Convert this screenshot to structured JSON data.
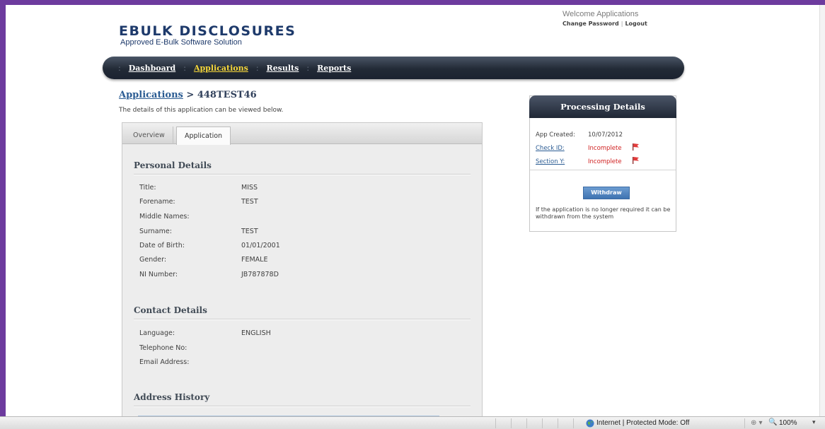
{
  "header": {
    "logo_title": "EBULK DISCLOSURES",
    "logo_subtitle": "Approved E-Bulk Software Solution",
    "welcome": "Welcome Applications",
    "change_password": "Change Password",
    "link_separator": "|",
    "logout": "Logout"
  },
  "nav": {
    "separator": ":",
    "items": [
      {
        "label": "Dashboard",
        "active": false
      },
      {
        "label": "Applications",
        "active": true
      },
      {
        "label": "Results",
        "active": false
      },
      {
        "label": "Reports",
        "active": false
      }
    ]
  },
  "breadcrumb": {
    "parent": "Applications",
    "separator": ">",
    "current": "448TEST46"
  },
  "intro": "The details of this application can be viewed below.",
  "tabs": [
    {
      "label": "Overview",
      "active": false
    },
    {
      "label": "Application",
      "active": true
    }
  ],
  "personal_details": {
    "title": "Personal Details",
    "fields": [
      {
        "label": "Title:",
        "value": "MISS"
      },
      {
        "label": "Forename:",
        "value": "TEST"
      },
      {
        "label": "Middle Names:",
        "value": ""
      },
      {
        "label": "Surname:",
        "value": "TEST"
      },
      {
        "label": "Date of Birth:",
        "value": "01/01/2001"
      },
      {
        "label": "Gender:",
        "value": "FEMALE"
      },
      {
        "label": "NI Number:",
        "value": "JB787878D"
      }
    ]
  },
  "contact_details": {
    "title": "Contact Details",
    "fields": [
      {
        "label": "Language:",
        "value": "ENGLISH"
      },
      {
        "label": "Telephone No:",
        "value": ""
      },
      {
        "label": "Email Address:",
        "value": ""
      }
    ]
  },
  "address_history": {
    "title": "Address History"
  },
  "processing": {
    "title": "Processing Details",
    "app_created_label": "App Created:",
    "app_created_value": "10/07/2012",
    "check_id_label": "Check ID:",
    "check_id_status": "Incomplete",
    "section_y_label": "Section Y:",
    "section_y_status": "Incomplete",
    "withdraw_label": "Withdraw",
    "withdraw_note": "If the application is no longer required it can be withdrawn from the system",
    "incomplete_color": "#d02020"
  },
  "statusbar": {
    "zone": "Internet | Protected Mode: Off",
    "zoom": "100%"
  },
  "colors": {
    "brand_navy": "#1e3a6b",
    "active_nav": "#f6d73a",
    "link_blue": "#2b5c93",
    "window_border": "#6d3b9e"
  }
}
